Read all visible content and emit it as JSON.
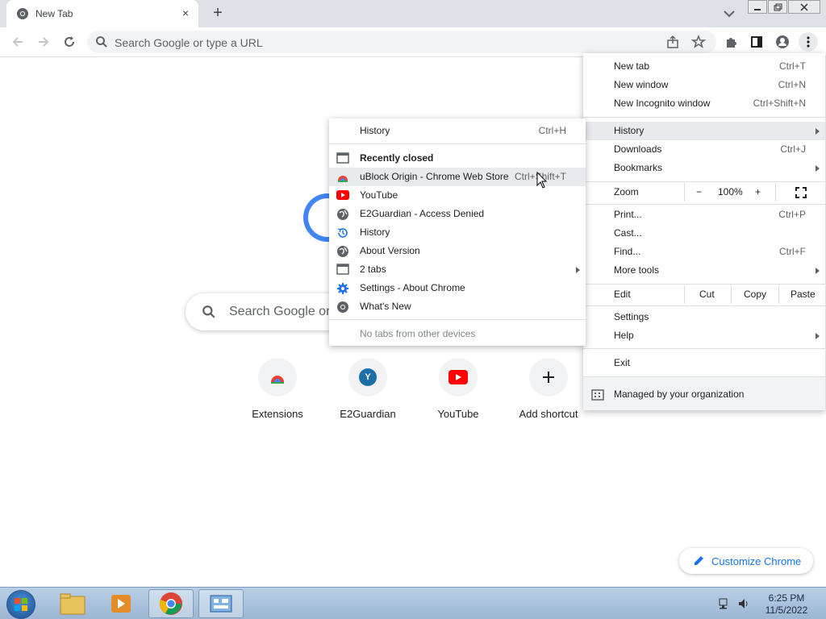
{
  "tab": {
    "title": "New Tab",
    "close": "×"
  },
  "toolbar": {
    "omnibox_placeholder": "Search Google or type a URL"
  },
  "ntp": {
    "search_placeholder": "Search Google or",
    "shortcuts": [
      {
        "label": "Extensions"
      },
      {
        "label": "E2Guardian",
        "letter": "Y"
      },
      {
        "label": "YouTube"
      },
      {
        "label": "Add shortcut"
      }
    ],
    "customize": "Customize Chrome"
  },
  "chrome_menu": {
    "new_tab": "New tab",
    "new_tab_key": "Ctrl+T",
    "new_window": "New window",
    "new_window_key": "Ctrl+N",
    "new_incognito": "New Incognito window",
    "new_incognito_key": "Ctrl+Shift+N",
    "history": "History",
    "downloads": "Downloads",
    "downloads_key": "Ctrl+J",
    "bookmarks": "Bookmarks",
    "zoom": "Zoom",
    "zoom_minus": "−",
    "zoom_value": "100%",
    "zoom_plus": "+",
    "print": "Print...",
    "print_key": "Ctrl+P",
    "cast": "Cast...",
    "find": "Find...",
    "find_key": "Ctrl+F",
    "more_tools": "More tools",
    "edit": "Edit",
    "cut": "Cut",
    "copy": "Copy",
    "paste": "Paste",
    "settings": "Settings",
    "help": "Help",
    "exit": "Exit",
    "managed": "Managed by your organization"
  },
  "history_menu": {
    "history": "History",
    "history_key": "Ctrl+H",
    "recently_closed": "Recently closed",
    "items": [
      {
        "label": "uBlock Origin - Chrome Web Store",
        "key": "Ctrl+Shift+T",
        "icon": "ublock-icon"
      },
      {
        "label": "YouTube",
        "icon": "youtube-icon"
      },
      {
        "label": "E2Guardian - Access Denied",
        "icon": "globe-icon"
      },
      {
        "label": "History",
        "icon": "history-icon"
      },
      {
        "label": "About Version",
        "icon": "globe-icon"
      },
      {
        "label": "2 tabs",
        "icon": "window-icon"
      },
      {
        "label": "Settings - About Chrome",
        "icon": "settings-gear-icon"
      },
      {
        "label": "What's New",
        "icon": "chrome-icon"
      }
    ],
    "no_tabs": "No tabs from other devices"
  },
  "taskbar": {
    "time": "6:25 PM",
    "date": "11/5/2022"
  },
  "colors": {
    "accent": "#1a73e8",
    "youtube": "#ff0000",
    "tabstrip": "#dee1e6"
  }
}
